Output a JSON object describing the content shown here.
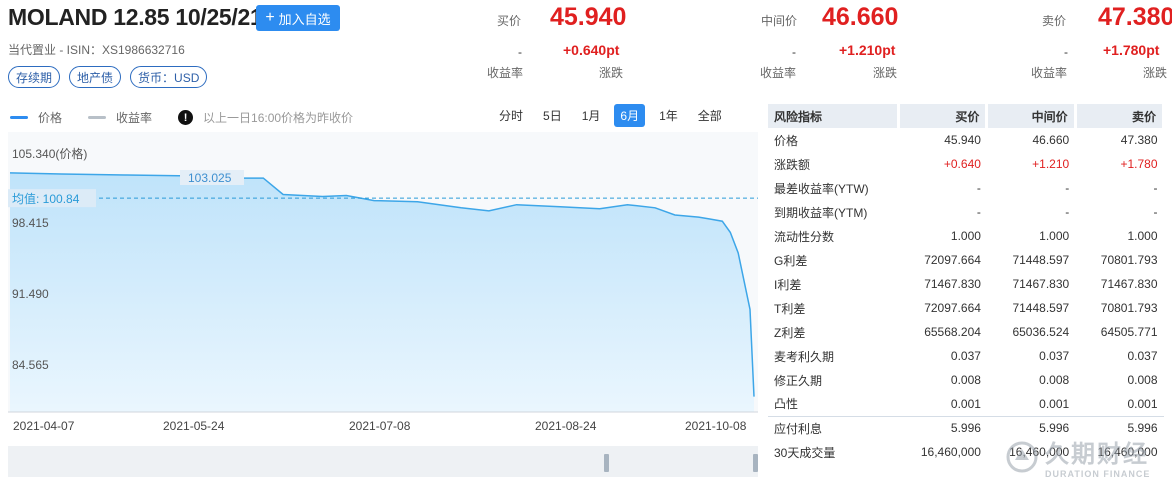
{
  "header": {
    "title": "MOLAND 12.85 10/25/21",
    "add_button": "加入自选",
    "issuer_line": "当代置业 - ISIN：XS1986632716",
    "tags": [
      "存续期",
      "地产债",
      "货币：USD"
    ]
  },
  "quotes": [
    {
      "label": "买价",
      "price": "45.940",
      "yield": "-",
      "change": "+0.640pt",
      "yield_label": "收益率",
      "change_label": "涨跌"
    },
    {
      "label": "中间价",
      "price": "46.660",
      "yield": "-",
      "change": "+1.210pt",
      "yield_label": "收益率",
      "change_label": "涨跌"
    },
    {
      "label": "卖价",
      "price": "47.380",
      "yield": "-",
      "change": "+1.780pt",
      "yield_label": "收益率",
      "change_label": "涨跌"
    }
  ],
  "legend": {
    "price": "价格",
    "yield": "收益率",
    "note": "以上一日16:00价格为昨收价"
  },
  "periods": [
    "分时",
    "5日",
    "1月",
    "6月",
    "1年",
    "全部"
  ],
  "active_period": "6月",
  "chart_data": {
    "type": "area",
    "series": [
      {
        "name": "价格",
        "x": [
          "2021-04-07",
          "2021-04-20",
          "2021-05-06",
          "2021-05-24",
          "2021-06-04",
          "2021-06-10",
          "2021-06-15",
          "2021-06-25",
          "2021-07-01",
          "2021-07-08",
          "2021-07-19",
          "2021-07-30",
          "2021-08-06",
          "2021-08-13",
          "2021-08-24",
          "2021-09-03",
          "2021-09-10",
          "2021-09-17",
          "2021-09-22",
          "2021-09-28",
          "2021-10-01",
          "2021-10-04",
          "2021-10-06",
          "2021-10-08",
          "2021-10-11",
          "2021-10-12"
        ],
        "values": [
          103.3,
          103.2,
          103.1,
          103.0,
          102.8,
          102.8,
          101.2,
          101.0,
          101.1,
          100.6,
          100.5,
          99.9,
          99.6,
          100.2,
          100.0,
          99.8,
          100.2,
          99.9,
          99.2,
          99.0,
          98.8,
          98.6,
          97.5,
          95.5,
          90.0,
          45.94
        ]
      }
    ],
    "y_ticks": [
      "105.340(价格)",
      "98.415",
      "91.490",
      "84.565"
    ],
    "x_ticks": [
      "2021-04-07",
      "2021-05-24",
      "2021-07-08",
      "2021-08-24",
      "2021-10-08"
    ],
    "max_label": "103.025",
    "mean_label": "均值: 100.84",
    "mean_value": 100.84,
    "ylim_display": [
      80.0,
      105.34
    ],
    "grid": false,
    "colors": {
      "line": "#3da6e8",
      "fill_top": "#bfe3fa",
      "fill_bottom": "#eaf6fe",
      "mean": "#2a9bd8"
    }
  },
  "risk": {
    "headers": [
      "风险指标",
      "买价",
      "中间价",
      "卖价"
    ],
    "rows": [
      {
        "name": "价格",
        "bid": "45.940",
        "mid": "46.660",
        "ask": "47.380"
      },
      {
        "name": "涨跌额",
        "bid": "+0.640",
        "mid": "+1.210",
        "ask": "+1.780",
        "red": true
      },
      {
        "name": "最差收益率(YTW)",
        "bid": "-",
        "mid": "-",
        "ask": "-"
      },
      {
        "name": "到期收益率(YTM)",
        "bid": "-",
        "mid": "-",
        "ask": "-"
      },
      {
        "name": "流动性分数",
        "bid": "1.000",
        "mid": "1.000",
        "ask": "1.000"
      },
      {
        "name": "G利差",
        "bid": "72097.664",
        "mid": "71448.597",
        "ask": "70801.793"
      },
      {
        "name": "I利差",
        "bid": "71467.830",
        "mid": "71467.830",
        "ask": "71467.830"
      },
      {
        "name": "T利差",
        "bid": "72097.664",
        "mid": "71448.597",
        "ask": "70801.793"
      },
      {
        "name": "Z利差",
        "bid": "65568.204",
        "mid": "65036.524",
        "ask": "64505.771"
      },
      {
        "name": "麦考利久期",
        "bid": "0.037",
        "mid": "0.037",
        "ask": "0.037"
      },
      {
        "name": "修正久期",
        "bid": "0.008",
        "mid": "0.008",
        "ask": "0.008"
      },
      {
        "name": "凸性",
        "bid": "0.001",
        "mid": "0.001",
        "ask": "0.001"
      },
      {
        "name": "应付利息",
        "bid": "5.996",
        "mid": "5.996",
        "ask": "5.996",
        "sep": true
      },
      {
        "name": "30天成交量",
        "bid": "16,460,000",
        "mid": "16,460,000",
        "ask": "16,460,000"
      }
    ]
  },
  "watermark": {
    "cn": "久期财经",
    "en": "DURATION FINANCE"
  }
}
